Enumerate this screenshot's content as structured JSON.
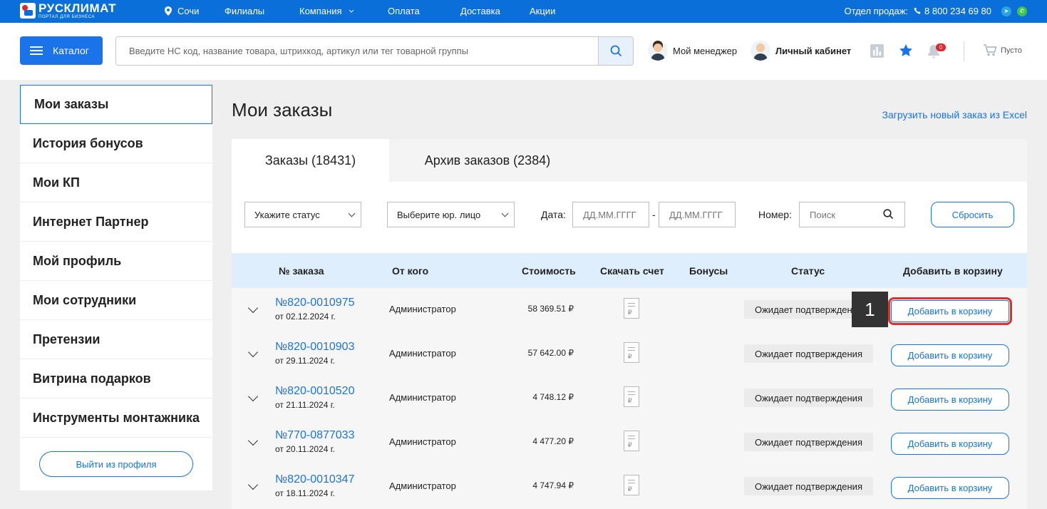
{
  "topbar": {
    "logo_name": "РУСКЛИМАТ",
    "logo_sub": "ПОРТАЛ ДЛЯ БИЗНЕСА",
    "city": "Сочи",
    "nav": [
      "Филиалы",
      "Компания",
      "Оплата",
      "Доставка",
      "Акции"
    ],
    "sales_label": "Отдел продаж:",
    "phone": "8 800 234 69 80"
  },
  "header": {
    "catalog_label": "Каталог",
    "search_placeholder": "Введите НС код, название товара, штрихкод, артикул или тег товарной группы",
    "manager_label": "Мой менеджер",
    "cabinet_label": "Личный кабинет",
    "notifications_count": "0",
    "cart_label": "Пусто"
  },
  "sidebar": {
    "items": [
      "Мои заказы",
      "История бонусов",
      "Мои КП",
      "Интернет Партнер",
      "Мой профиль",
      "Мои сотрудники",
      "Претензии",
      "Витрина подарков",
      "Инструменты монтажника"
    ],
    "logout_label": "Выйти из профиля"
  },
  "main": {
    "title": "Мои заказы",
    "excel_link": "Загрузить новый заказ из Excel",
    "tabs": [
      {
        "label": "Заказы (18431)",
        "active": true
      },
      {
        "label": "Архив заказов (2384)",
        "active": false
      }
    ],
    "filters": {
      "status_placeholder": "Укажите статус",
      "entity_placeholder": "Выберите юр. лицо",
      "date_label": "Дата:",
      "date_from_placeholder": "ДД.ММ.ГГГГ",
      "date_separator": "-",
      "date_to_placeholder": "ДД.ММ.ГГГГ",
      "number_label": "Номер:",
      "number_placeholder": "Поиск",
      "reset_label": "Сбросить"
    },
    "table": {
      "headers": [
        "№ заказа",
        "От кого",
        "Стоимость",
        "Скачать счет",
        "Бонусы",
        "Статус",
        "Добавить в корзину"
      ],
      "rows": [
        {
          "number": "№820-0010975",
          "date": "от 02.12.2024 г.",
          "from": "Администратор",
          "price": "58 369.51 ₽",
          "status": "Ожидает подтверждения",
          "action": "Добавить в корзину"
        },
        {
          "number": "№820-0010903",
          "date": "от 29.11.2024 г.",
          "from": "Администратор",
          "price": "57 642.00 ₽",
          "status": "Ожидает подтверждения",
          "action": "Добавить в корзину"
        },
        {
          "number": "№820-0010520",
          "date": "от 21.11.2024 г.",
          "from": "Администратор",
          "price": "4 748.12 ₽",
          "status": "Ожидает подтверждения",
          "action": "Добавить в корзину"
        },
        {
          "number": "№770-0877033",
          "date": "от 20.11.2024 г.",
          "from": "Администратор",
          "price": "4 477.20 ₽",
          "status": "Ожидает подтверждения",
          "action": "Добавить в корзину"
        },
        {
          "number": "№820-0010347",
          "date": "от 18.11.2024 г.",
          "from": "Администратор",
          "price": "4 747.94 ₽",
          "status": "Ожидает подтверждения",
          "action": "Добавить в корзину"
        }
      ]
    },
    "annotation_marker": "1"
  },
  "colors": {
    "primary": "#0a6fd9",
    "accent": "#1a73e8",
    "highlight": "#d9342b"
  },
  "icons": [
    "location-pin-icon",
    "phone-icon",
    "telegram-icon",
    "whatsapp-icon",
    "search-icon",
    "stats-icon",
    "star-icon",
    "bell-icon",
    "cart-icon",
    "chevron-down-icon",
    "document-icon"
  ]
}
